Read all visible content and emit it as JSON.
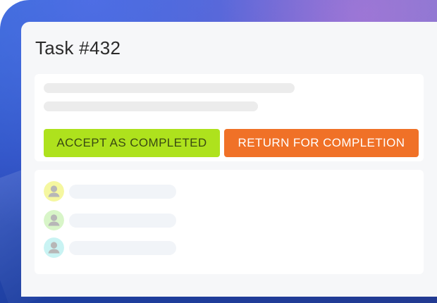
{
  "task": {
    "title": "Task #432"
  },
  "actions": {
    "accept_label": "ACCEPT AS COMPLETED",
    "return_label": "RETURN FOR COMPLETION"
  },
  "participants": [
    {
      "avatar_icon": "user-icon",
      "avatar_color": "#f5f7a0"
    },
    {
      "avatar_icon": "user-icon",
      "avatar_color": "#d8f5c8"
    },
    {
      "avatar_icon": "user-icon",
      "avatar_color": "#c9f3f3"
    }
  ],
  "colors": {
    "accept": "#aee21d",
    "return": "#f07127",
    "brand_gradient_start": "#2f6fd4",
    "brand_gradient_end": "#9268d4"
  }
}
